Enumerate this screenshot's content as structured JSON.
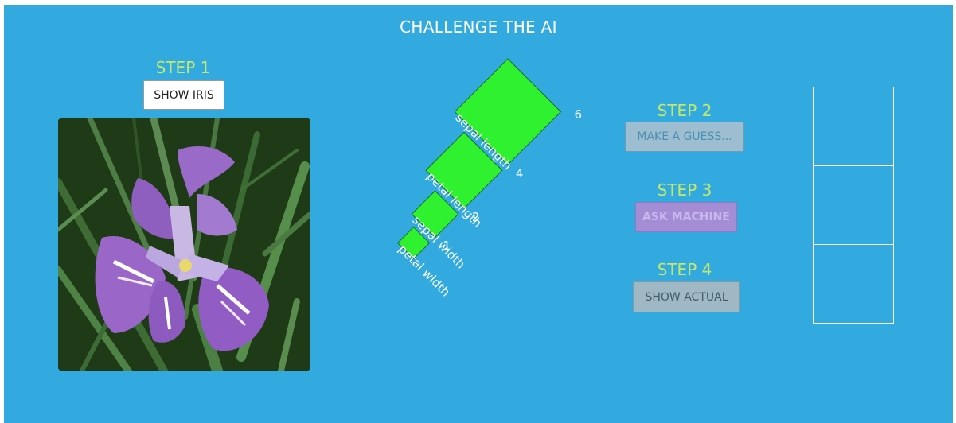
{
  "title": "CHALLENGE THE AI",
  "colors": {
    "background": "#33aadf",
    "step_label": "#c5e86b",
    "bar_fill": "#2ff12f",
    "text_white": "#ffffff"
  },
  "step1": {
    "label": "STEP 1",
    "button": "SHOW IRIS"
  },
  "step2": {
    "label": "STEP 2",
    "button": "MAKE A GUESS..."
  },
  "step3": {
    "label": "STEP 3",
    "button": "ASK MACHINE"
  },
  "step4": {
    "label": "STEP 4",
    "button": "SHOW ACTUAL"
  },
  "image": {
    "subject": "iris-flower-photo"
  },
  "measurements": [
    {
      "feature": "petal width",
      "value": 1
    },
    {
      "feature": "sepal width",
      "value": 2
    },
    {
      "feature": "petal length",
      "value": 4
    },
    {
      "feature": "sepal length",
      "value": 6
    }
  ],
  "answer_slots": 3
}
